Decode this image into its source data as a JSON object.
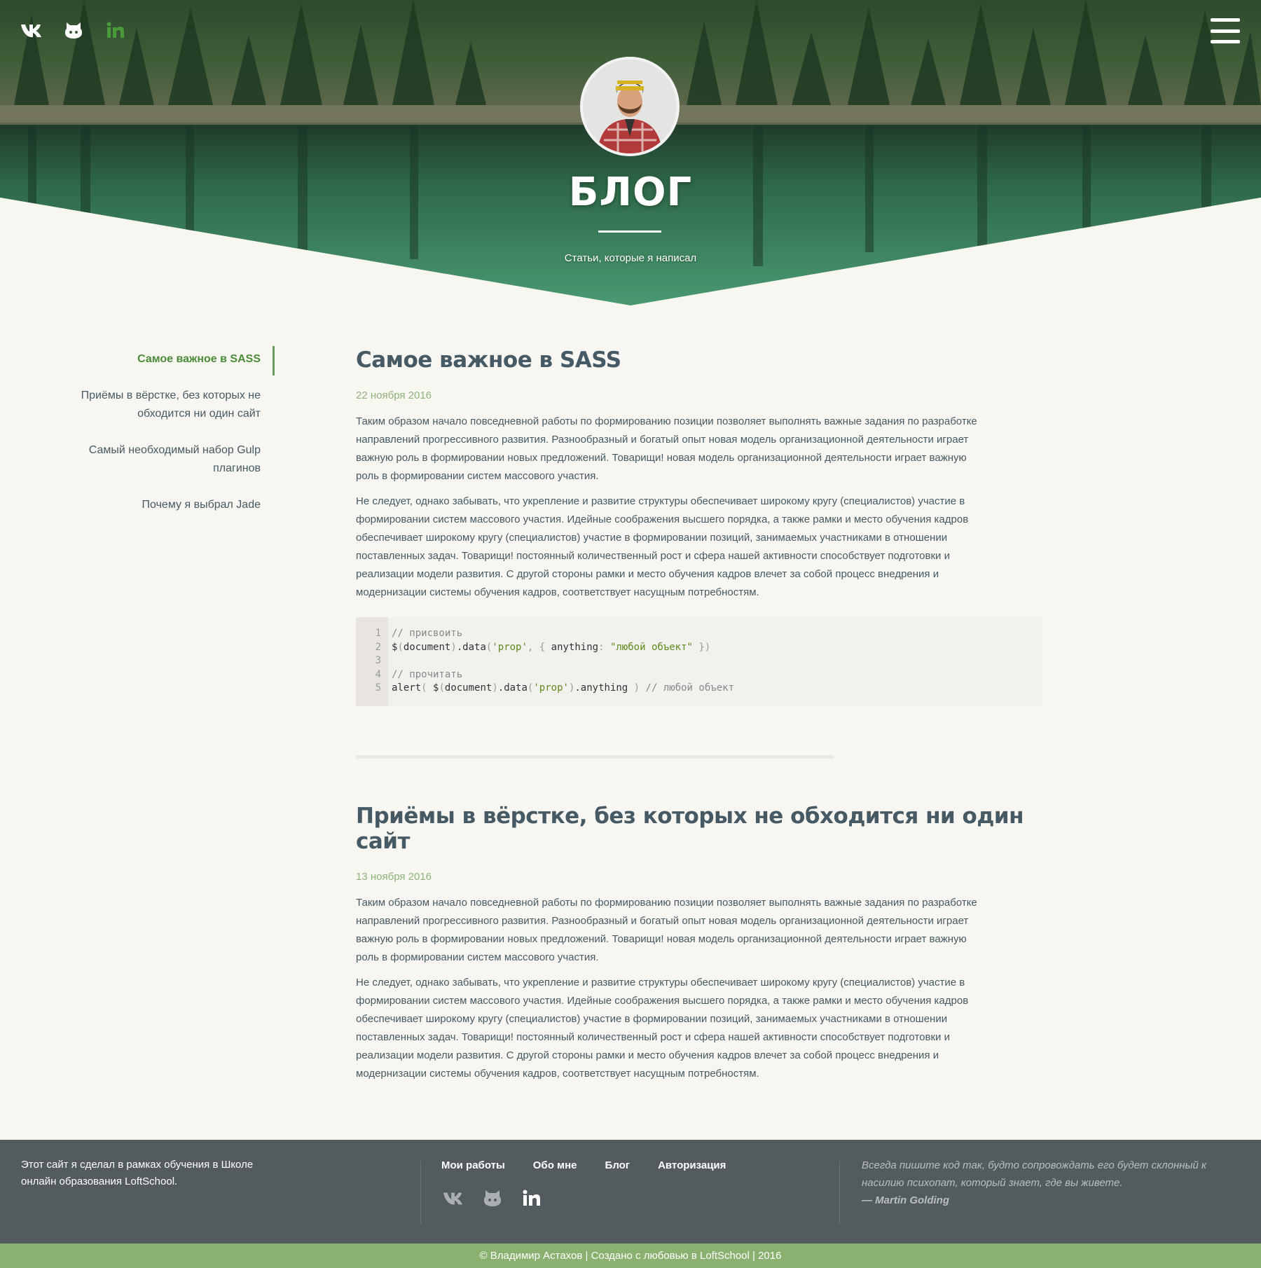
{
  "header": {
    "title": "БЛОГ",
    "subtitle": "Статьи, которые я написал",
    "social_icons": [
      "vk-icon",
      "github-icon",
      "linkedin-icon"
    ],
    "menu_icon": "hamburger-menu-icon"
  },
  "sidebar": {
    "items": [
      {
        "label": "Самое важное в SASS",
        "active": true
      },
      {
        "label": "Приёмы в вёрстке, без которых не обходится ни один сайт",
        "active": false
      },
      {
        "label": "Самый необходимый набор Gulp плагинов",
        "active": false
      },
      {
        "label": "Почему я выбрал Jade",
        "active": false
      }
    ]
  },
  "posts": [
    {
      "title": "Самое важное в SASS",
      "date": "22 ноября 2016",
      "paragraphs": [
        "Таким образом начало повседневной работы по формированию позиции позволяет выполнять важные задания по разработке направлений прогрессивного развития. Разнообразный и богатый опыт новая модель организационной деятельности играет важную роль в формировании новых предложений. Товарищи! новая модель организационной деятельности играет важную роль в формировании систем массового участия.",
        "Не следует, однако забывать, что укрепление и развитие структуры обеспечивает широкому кругу (специалистов) участие в формировании систем массового участия. Идейные соображения высшего порядка, а также рамки и место обучения кадров обеспечивает широкому кругу (специалистов) участие в формировании позиций, занимаемых участниками в отношении поставленных задач. Товарищи! постоянный количественный рост и сфера нашей активности способствует подготовки и реализации модели развития. С другой стороны рамки и место обучения кадров влечет за собой процесс внедрения и модернизации системы обучения кадров, соответствует насущным потребностям."
      ],
      "code": {
        "line_numbers": [
          "1",
          "2",
          "3",
          "4",
          "5"
        ],
        "comment1": "// присвоить",
        "comment2": "// прочитать",
        "comment3": "// любой объект",
        "string_prop": "'prop'",
        "string_value": "\"любой объект\""
      }
    },
    {
      "title": "Приёмы в вёрстке, без которых не обходится ни один сайт",
      "date": "13 ноября 2016",
      "paragraphs": [
        "Таким образом начало повседневной работы по формированию позиции позволяет выполнять важные задания по разработке направлений прогрессивного развития. Разнообразный и богатый опыт новая модель организационной деятельности играет важную роль в формировании новых предложений. Товарищи! новая модель организационной деятельности играет важную роль в формировании систем массового участия.",
        "Не следует, однако забывать, что укрепление и развитие структуры обеспечивает широкому кругу (специалистов) участие в формировании систем массового участия. Идейные соображения высшего порядка, а также рамки и место обучения кадров обеспечивает широкому кругу (специалистов) участие в формировании позиций, занимаемых участниками в отношении поставленных задач. Товарищи! постоянный количественный рост и сфера нашей активности способствует подготовки и реализации модели развития. С другой стороны рамки и место обучения кадров влечет за собой процесс внедрения и модернизации системы обучения кадров, соответствует насущным потребностям."
      ]
    }
  ],
  "footer": {
    "about": "Этот сайт я сделал в рамках обучения в Школе онлайн образования LoftSchool.",
    "nav": [
      "Мои работы",
      "Обо мне",
      "Блог",
      "Авторизация"
    ],
    "quote": "Всегда пишите код так, будто сопровождать его будет склонный к насилию психопат, который знает, где вы живете.",
    "quote_author": "— Martin Golding",
    "copyright": "© Владимир Астахов | Создано с любовью в LoftSchool | 2016"
  },
  "colors": {
    "accent_green": "#4a8b3a",
    "date_green": "#8fb27c",
    "text": "#455a64",
    "footer_bg": "#545b5f",
    "copyright_bg": "#8ab170",
    "page_bg": "#f8f6f1"
  }
}
